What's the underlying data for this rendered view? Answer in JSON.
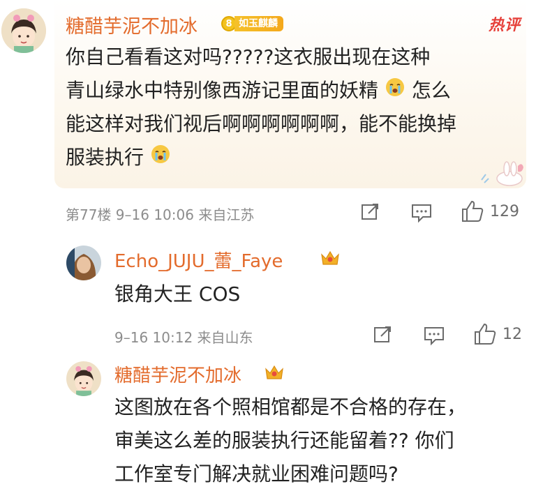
{
  "hot_label": "热评",
  "main_comment": {
    "username": "糖醋芋泥不加冰",
    "badge_level": "8",
    "badge_label": "如玉麒麟",
    "lines": [
      "你自己看看这对吗?????这衣服出现在这种",
      "青山绿水中特别像西游记里面的妖精",
      "能这样对我们视后啊啊啊啊啊啊，能不能换掉",
      "服装执行"
    ],
    "line2_tail": "怎么",
    "meta": "第77楼 9–16 10:06 来自江苏",
    "like_count": "129"
  },
  "replies": [
    {
      "username": "Echo_JUJU_蕾_Faye",
      "text": "银角大王 COS",
      "meta": "9–16 10:12 来自山东",
      "like_count": "12"
    },
    {
      "username": "糖醋芋泥不加冰",
      "lines": [
        "这图放在各个照相馆都是不合格的存在，",
        "审美这么差的服装执行还能留着?? 你们",
        "工作室专门解决就业困难问题吗?"
      ]
    }
  ],
  "colors": {
    "username": "#e36b2c",
    "meta": "#8c8c8c",
    "hot": "#e6403a"
  }
}
